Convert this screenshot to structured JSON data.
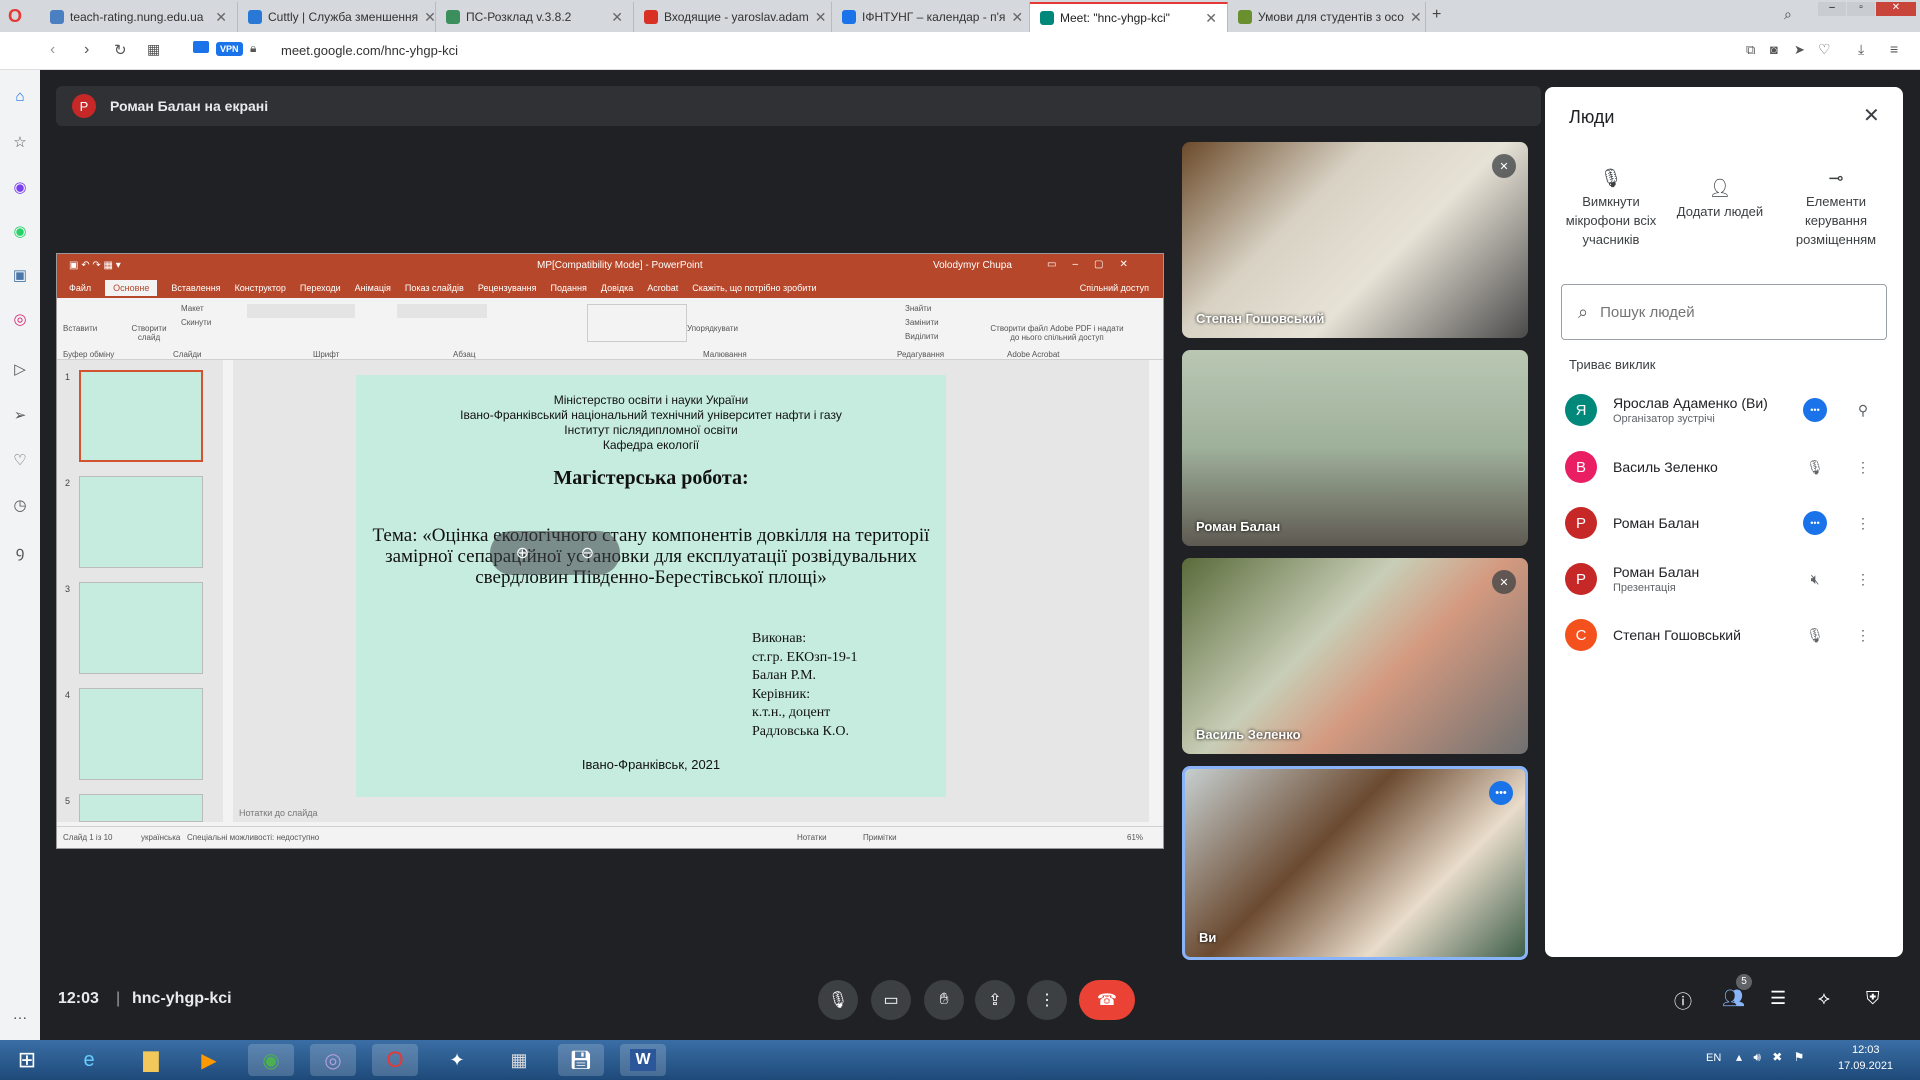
{
  "browser": {
    "tabs": [
      {
        "title": "teach-rating.nung.edu.ua",
        "color": "#4a7fc1"
      },
      {
        "title": "Cuttly | Служба зменшення",
        "color": "#2a78d6"
      },
      {
        "title": "ПС-Розклад v.3.8.2",
        "color": "#3a8f5c"
      },
      {
        "title": "Входящие - yaroslav.adam",
        "color": "#d93025"
      },
      {
        "title": "ІФНТУНГ – календар - п'я",
        "color": "#1a73e8"
      },
      {
        "title": "Meet: \"hnc-yhgp-kci\"",
        "color": "#00897b"
      },
      {
        "title": "Умови для студентів з осо",
        "color": "#6a8f2f"
      }
    ],
    "url": "meet.google.com/hnc-yhgp-kci",
    "vpn_label": "VPN"
  },
  "meet": {
    "presenter_banner": "Роман Балан на екрані",
    "presenter_initial": "Р",
    "time": "12:03",
    "meeting_code": "hnc-yhgp-kci",
    "participants_count": "5",
    "tiles": [
      {
        "name": "Степан Гошовський"
      },
      {
        "name": "Роман Балан"
      },
      {
        "name": "Василь Зеленко"
      },
      {
        "name": "Ви"
      }
    ]
  },
  "powerpoint": {
    "window_title": "МР[Compatibility Mode] - PowerPoint",
    "user": "Volodymyr Chupa",
    "tabs": [
      "Файл",
      "Основне",
      "Вставлення",
      "Конструктор",
      "Переходи",
      "Анімація",
      "Показ слайдів",
      "Рецензування",
      "Подання",
      "Довідка",
      "Acrobat",
      "Скажіть, що потрібно зробити"
    ],
    "share": "Спільний доступ",
    "groups": [
      "Буфер обміну",
      "Слайди",
      "Шрифт",
      "Абзац",
      "Малювання",
      "Редагування",
      "Adobe Acrobat"
    ],
    "ribbon_buttons": [
      "Вставити",
      "Створити слайд",
      "Макет",
      "Скинути",
      "Упорядкувати",
      "Знайти",
      "Замінити",
      "Виділити",
      "Створити файл Adobe PDF і надати до нього спільний доступ"
    ],
    "thumb_numbers": [
      "1",
      "2",
      "3",
      "4",
      "5"
    ],
    "notes": "Нотатки до слайда",
    "status": {
      "slide": "Слайд 1 із 10",
      "lang": "українська",
      "access": "Спеціальні можливості: недоступно",
      "notes": "Нотатки",
      "comments": "Примітки",
      "zoom": "61%"
    }
  },
  "slide": {
    "line1": "Міністерство освіти і науки України",
    "line2": "Івано-Франківський національний технічний університет нафти і газу",
    "line3": "Інститут післядипломної освіти",
    "line4": "Кафедра екології",
    "title": "Магістерська робота:",
    "theme": "Тема: «Оцінка екологічного стану компонентів довкілля на території замірної сепараційної установки для експлуатації розвідувальних свердловин Південно-Берестівської площі»",
    "author_label": "Виконав:",
    "group": "ст.гр. ЕКОзп-19-1",
    "author": "Балан Р.М.",
    "sup_label": "Керівник:",
    "sup_title": "к.т.н., доцент",
    "supervisor": "Радловська К.О.",
    "city": "Івано-Франківськ, 2021"
  },
  "people_panel": {
    "title": "Люди",
    "actions": [
      "Вимкнути мікрофони всіх учасників",
      "Додати людей",
      "Елементи керування розміщенням"
    ],
    "search_placeholder": "Пошук людей",
    "section": "Триває виклик",
    "list": [
      {
        "initial": "Я",
        "name": "Ярослав Адаменко (Ви)",
        "sub": "Організатор зустрічі",
        "color": "#00897b"
      },
      {
        "initial": "В",
        "name": "Василь Зеленко",
        "sub": "",
        "color": "#e91e63"
      },
      {
        "initial": "Р",
        "name": "Роман Балан",
        "sub": "",
        "color": "#c62828"
      },
      {
        "initial": "Р",
        "name": "Роман Балан",
        "sub": "Презентація",
        "color": "#c62828"
      },
      {
        "initial": "С",
        "name": "Степан Гошовський",
        "sub": "",
        "color": "#f4511e"
      }
    ]
  },
  "taskbar": {
    "lang": "EN",
    "time": "12:03",
    "date": "17.09.2021"
  }
}
